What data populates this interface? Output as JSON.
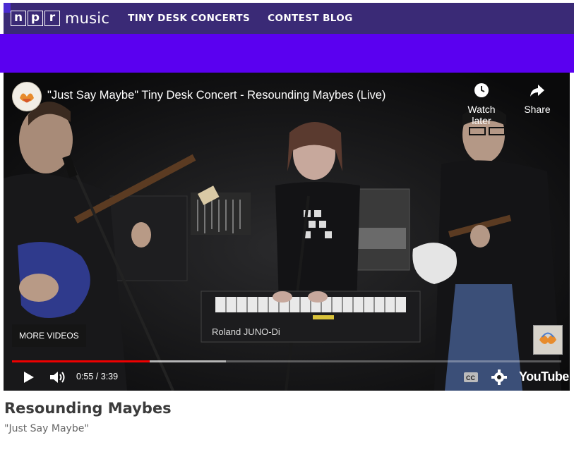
{
  "header": {
    "logo_letters": [
      "n",
      "p",
      "r"
    ],
    "logo_word": "music",
    "nav": [
      {
        "label": "TINY DESK CONCERTS"
      },
      {
        "label": "CONTEST BLOG"
      }
    ]
  },
  "video": {
    "title": "\"Just Say Maybe\" Tiny Desk Concert - Resounding Maybes (Live)",
    "watch_later_label": "Watch later",
    "share_label": "Share",
    "more_videos_label": "MORE VIDEOS",
    "time_display": "0:55 / 3:39",
    "progress_fraction": 0.251,
    "buffered_fraction": 0.39,
    "youtube_label": "YouTube",
    "keyboard_brand": "Roland JUNO-Di",
    "colors": {
      "progress": "#ee0000",
      "nav_bg": "#3a2a76",
      "strip": "#5a00f0"
    }
  },
  "content": {
    "artist": "Resounding Maybes",
    "song": "\"Just Say Maybe\""
  }
}
